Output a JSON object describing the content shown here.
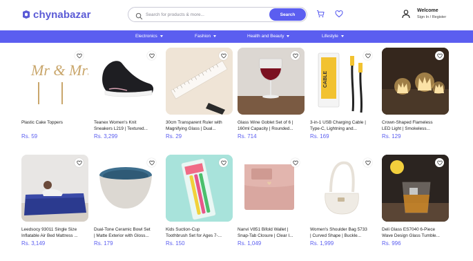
{
  "brand": {
    "name": "chynabazar",
    "accent": "#5b5ef0",
    "brand_color": "#5b5bd6"
  },
  "search": {
    "placeholder": "Search for products & more...",
    "value": "",
    "button_label": "Search"
  },
  "header": {
    "welcome": "Welcome",
    "signin": "Sign In / Register",
    "cart_icon": "cart-icon",
    "wishlist_icon": "heart-icon",
    "user_icon": "user-icon"
  },
  "nav": {
    "items": [
      {
        "label": "Electronics"
      },
      {
        "label": "Fashion"
      },
      {
        "label": "Health and Beauty"
      },
      {
        "label": "Lifestyle"
      }
    ]
  },
  "products": [
    {
      "name_line1": "Plastic Cake Toppers",
      "name_line2": "",
      "price": "Rs. 59"
    },
    {
      "name_line1": "Teanex Women's Knit",
      "name_line2": "Sneakers L219 | Textured...",
      "price": "Rs. 3,299"
    },
    {
      "name_line1": "30cm Transparent Ruler with",
      "name_line2": "Magnifying Glass | Dual...",
      "price": "Rs. 29"
    },
    {
      "name_line1": "Glass Wine Goblet Set of 6 |",
      "name_line2": "160ml Capacity | Rounded...",
      "price": "Rs. 714"
    },
    {
      "name_line1": "3-in-1 USB Charging Cable |",
      "name_line2": "Type-C, Lightning and...",
      "price": "Rs. 169"
    },
    {
      "name_line1": "Crown-Shaped Flameless",
      "name_line2": "LED Light | Smokeless...",
      "price": "Rs. 129"
    },
    {
      "name_line1": "Leedsocy 93011 Single Size",
      "name_line2": "Inflatable Air Bed Mattress ...",
      "price": "Rs. 3,149"
    },
    {
      "name_line1": "Dual-Tone Ceramic Bowl Set",
      "name_line2": "| Matte Exterior with Gloss...",
      "price": "Rs. 179"
    },
    {
      "name_line1": "Kids Suction-Cup",
      "name_line2": "Toothbrush Set for Ages 7-...",
      "price": "Rs. 150"
    },
    {
      "name_line1": "Nanvi V851 Bifold Wallet |",
      "name_line2": "Snap-Tab Closure | Clear I...",
      "price": "Rs. 1,049"
    },
    {
      "name_line1": "Women's Shoulder Bag 5733",
      "name_line2": "| Curved Shape | Buckle...",
      "price": "Rs. 1,999"
    },
    {
      "name_line1": "Deli Glass ES7040 6-Piece",
      "name_line2": "Wave Design Glass Tumble...",
      "price": "Rs. 996"
    }
  ],
  "topper_text": "Mr & Mrs",
  "cable_box_text": "CABLE"
}
